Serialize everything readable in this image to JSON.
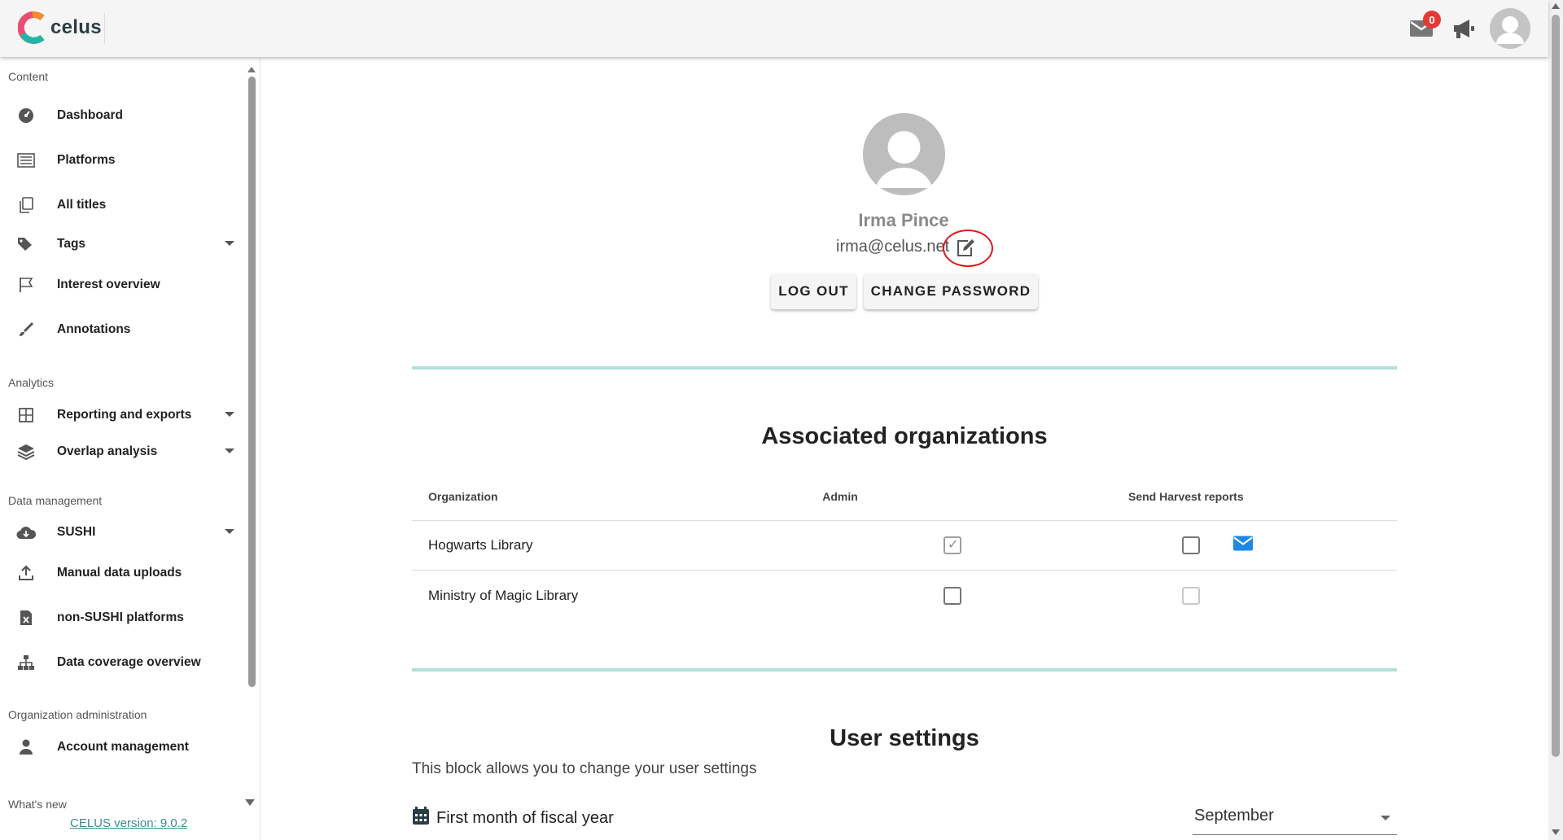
{
  "app": {
    "logo_text": "celus"
  },
  "topbar": {
    "notification_count": "0"
  },
  "sidebar": {
    "sections": {
      "content": "Content",
      "analytics": "Analytics",
      "data_management": "Data management",
      "org_admin": "Organization administration",
      "whats_new": "What's new"
    },
    "items": {
      "dashboard": "Dashboard",
      "platforms": "Platforms",
      "all_titles": "All titles",
      "tags": "Tags",
      "interest_overview": "Interest overview",
      "annotations": "Annotations",
      "reporting": "Reporting and exports",
      "overlap": "Overlap analysis",
      "sushi": "SUSHI",
      "manual_uploads": "Manual data uploads",
      "non_sushi": "non-SUSHI platforms",
      "coverage": "Data coverage overview",
      "account_mgmt": "Account management"
    },
    "version": "CELUS version: 9.0.2"
  },
  "profile": {
    "name": "Irma Pince",
    "email": "irma@celus.net",
    "logout_label": "LOG OUT",
    "change_password_label": "CHANGE PASSWORD"
  },
  "organizations": {
    "title": "Associated organizations",
    "headers": {
      "organization": "Organization",
      "admin": "Admin",
      "send_reports": "Send Harvest reports"
    },
    "rows": [
      {
        "name": "Hogwarts Library",
        "admin": true,
        "admin_disabled": true,
        "send_reports": false,
        "send_disabled": false,
        "show_mail_icon": true
      },
      {
        "name": "Ministry of Magic Library",
        "admin": false,
        "admin_disabled": false,
        "send_reports": false,
        "send_disabled": true,
        "show_mail_icon": false
      }
    ]
  },
  "user_settings": {
    "title": "User settings",
    "description": "This block allows you to change your user settings",
    "fiscal_label": "First month of fiscal year",
    "fiscal_value": "September"
  },
  "colors": {
    "accent": "#b2dfdb",
    "link": "#3d8b8b",
    "badge": "#e53935",
    "mail_blue": "#1e88e5",
    "highlight": "#e0151c"
  }
}
